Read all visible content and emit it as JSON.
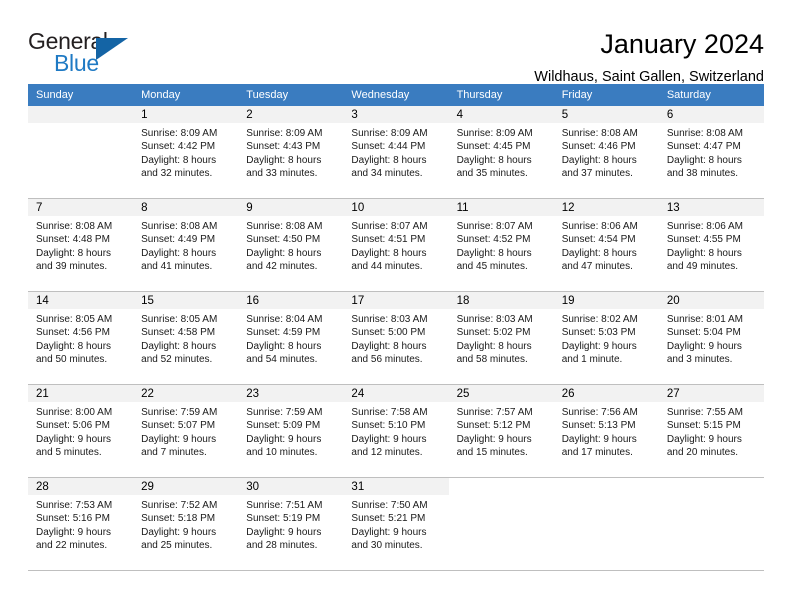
{
  "brand": {
    "name_part1": "General",
    "name_part2": "Blue",
    "accent_color": "#1464a5",
    "logo_icon": "triangle-flag-icon"
  },
  "header": {
    "title": "January 2024",
    "subtitle": "Wildhaus, Saint Gallen, Switzerland"
  },
  "theme": {
    "header_row_bg": "#3a7cc0",
    "day_number_bg": "#f2f2f2",
    "grid_line": "#bfbfbf"
  },
  "weekday_headers": [
    "Sunday",
    "Monday",
    "Tuesday",
    "Wednesday",
    "Thursday",
    "Friday",
    "Saturday"
  ],
  "weeks": [
    [
      {
        "day": "",
        "lines": []
      },
      {
        "day": "1",
        "lines": [
          "Sunrise: 8:09 AM",
          "Sunset: 4:42 PM",
          "Daylight: 8 hours",
          "and 32 minutes."
        ]
      },
      {
        "day": "2",
        "lines": [
          "Sunrise: 8:09 AM",
          "Sunset: 4:43 PM",
          "Daylight: 8 hours",
          "and 33 minutes."
        ]
      },
      {
        "day": "3",
        "lines": [
          "Sunrise: 8:09 AM",
          "Sunset: 4:44 PM",
          "Daylight: 8 hours",
          "and 34 minutes."
        ]
      },
      {
        "day": "4",
        "lines": [
          "Sunrise: 8:09 AM",
          "Sunset: 4:45 PM",
          "Daylight: 8 hours",
          "and 35 minutes."
        ]
      },
      {
        "day": "5",
        "lines": [
          "Sunrise: 8:08 AM",
          "Sunset: 4:46 PM",
          "Daylight: 8 hours",
          "and 37 minutes."
        ]
      },
      {
        "day": "6",
        "lines": [
          "Sunrise: 8:08 AM",
          "Sunset: 4:47 PM",
          "Daylight: 8 hours",
          "and 38 minutes."
        ]
      }
    ],
    [
      {
        "day": "7",
        "lines": [
          "Sunrise: 8:08 AM",
          "Sunset: 4:48 PM",
          "Daylight: 8 hours",
          "and 39 minutes."
        ]
      },
      {
        "day": "8",
        "lines": [
          "Sunrise: 8:08 AM",
          "Sunset: 4:49 PM",
          "Daylight: 8 hours",
          "and 41 minutes."
        ]
      },
      {
        "day": "9",
        "lines": [
          "Sunrise: 8:08 AM",
          "Sunset: 4:50 PM",
          "Daylight: 8 hours",
          "and 42 minutes."
        ]
      },
      {
        "day": "10",
        "lines": [
          "Sunrise: 8:07 AM",
          "Sunset: 4:51 PM",
          "Daylight: 8 hours",
          "and 44 minutes."
        ]
      },
      {
        "day": "11",
        "lines": [
          "Sunrise: 8:07 AM",
          "Sunset: 4:52 PM",
          "Daylight: 8 hours",
          "and 45 minutes."
        ]
      },
      {
        "day": "12",
        "lines": [
          "Sunrise: 8:06 AM",
          "Sunset: 4:54 PM",
          "Daylight: 8 hours",
          "and 47 minutes."
        ]
      },
      {
        "day": "13",
        "lines": [
          "Sunrise: 8:06 AM",
          "Sunset: 4:55 PM",
          "Daylight: 8 hours",
          "and 49 minutes."
        ]
      }
    ],
    [
      {
        "day": "14",
        "lines": [
          "Sunrise: 8:05 AM",
          "Sunset: 4:56 PM",
          "Daylight: 8 hours",
          "and 50 minutes."
        ]
      },
      {
        "day": "15",
        "lines": [
          "Sunrise: 8:05 AM",
          "Sunset: 4:58 PM",
          "Daylight: 8 hours",
          "and 52 minutes."
        ]
      },
      {
        "day": "16",
        "lines": [
          "Sunrise: 8:04 AM",
          "Sunset: 4:59 PM",
          "Daylight: 8 hours",
          "and 54 minutes."
        ]
      },
      {
        "day": "17",
        "lines": [
          "Sunrise: 8:03 AM",
          "Sunset: 5:00 PM",
          "Daylight: 8 hours",
          "and 56 minutes."
        ]
      },
      {
        "day": "18",
        "lines": [
          "Sunrise: 8:03 AM",
          "Sunset: 5:02 PM",
          "Daylight: 8 hours",
          "and 58 minutes."
        ]
      },
      {
        "day": "19",
        "lines": [
          "Sunrise: 8:02 AM",
          "Sunset: 5:03 PM",
          "Daylight: 9 hours",
          "and 1 minute."
        ]
      },
      {
        "day": "20",
        "lines": [
          "Sunrise: 8:01 AM",
          "Sunset: 5:04 PM",
          "Daylight: 9 hours",
          "and 3 minutes."
        ]
      }
    ],
    [
      {
        "day": "21",
        "lines": [
          "Sunrise: 8:00 AM",
          "Sunset: 5:06 PM",
          "Daylight: 9 hours",
          "and 5 minutes."
        ]
      },
      {
        "day": "22",
        "lines": [
          "Sunrise: 7:59 AM",
          "Sunset: 5:07 PM",
          "Daylight: 9 hours",
          "and 7 minutes."
        ]
      },
      {
        "day": "23",
        "lines": [
          "Sunrise: 7:59 AM",
          "Sunset: 5:09 PM",
          "Daylight: 9 hours",
          "and 10 minutes."
        ]
      },
      {
        "day": "24",
        "lines": [
          "Sunrise: 7:58 AM",
          "Sunset: 5:10 PM",
          "Daylight: 9 hours",
          "and 12 minutes."
        ]
      },
      {
        "day": "25",
        "lines": [
          "Sunrise: 7:57 AM",
          "Sunset: 5:12 PM",
          "Daylight: 9 hours",
          "and 15 minutes."
        ]
      },
      {
        "day": "26",
        "lines": [
          "Sunrise: 7:56 AM",
          "Sunset: 5:13 PM",
          "Daylight: 9 hours",
          "and 17 minutes."
        ]
      },
      {
        "day": "27",
        "lines": [
          "Sunrise: 7:55 AM",
          "Sunset: 5:15 PM",
          "Daylight: 9 hours",
          "and 20 minutes."
        ]
      }
    ],
    [
      {
        "day": "28",
        "lines": [
          "Sunrise: 7:53 AM",
          "Sunset: 5:16 PM",
          "Daylight: 9 hours",
          "and 22 minutes."
        ]
      },
      {
        "day": "29",
        "lines": [
          "Sunrise: 7:52 AM",
          "Sunset: 5:18 PM",
          "Daylight: 9 hours",
          "and 25 minutes."
        ]
      },
      {
        "day": "30",
        "lines": [
          "Sunrise: 7:51 AM",
          "Sunset: 5:19 PM",
          "Daylight: 9 hours",
          "and 28 minutes."
        ]
      },
      {
        "day": "31",
        "lines": [
          "Sunrise: 7:50 AM",
          "Sunset: 5:21 PM",
          "Daylight: 9 hours",
          "and 30 minutes."
        ]
      },
      {
        "day": "",
        "lines": []
      },
      {
        "day": "",
        "lines": []
      },
      {
        "day": "",
        "lines": []
      }
    ]
  ]
}
